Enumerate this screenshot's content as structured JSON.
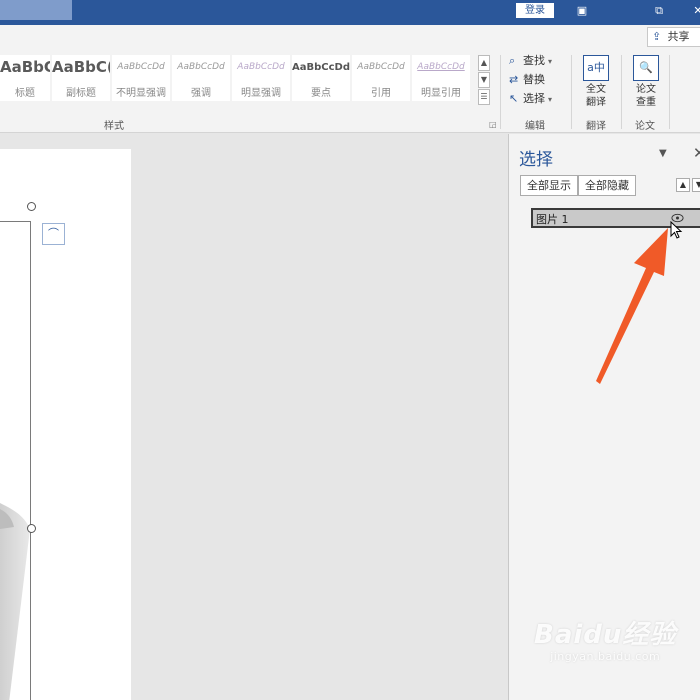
{
  "titlebar": {
    "login_label": "登录",
    "icons": [
      "ribbon-display-icon",
      "restore-icon",
      "close-icon"
    ],
    "close_glyph": "✕",
    "restore_glyph": "⧉",
    "ribbon_glyph": "▣"
  },
  "ribbon": {
    "share_label": "共享",
    "styles": [
      {
        "sample": "AaBbC(",
        "name": "标题"
      },
      {
        "sample": "AaBbC(",
        "name": "副标题"
      },
      {
        "sample": "AaBbCcDd",
        "name": "不明显强调"
      },
      {
        "sample": "AaBbCcDd",
        "name": "强调"
      },
      {
        "sample": "AaBbCcDd",
        "name": "明显强调"
      },
      {
        "sample": "AaBbCcDd",
        "name": "要点"
      },
      {
        "sample": "AaBbCcDd",
        "name": "引用"
      },
      {
        "sample": "AaBbCcDd",
        "name": "明显引用"
      }
    ],
    "styles_group_label": "样式",
    "editing": {
      "find_label": "查找",
      "replace_label": "替换",
      "select_label": "选择",
      "group_label": "编辑"
    },
    "translate": {
      "button_label_1": "全文",
      "button_label_2": "翻译",
      "group_label": "翻译"
    },
    "paper": {
      "button_label_1": "论文",
      "button_label_2": "查重",
      "group_label": "论文"
    }
  },
  "selection_pane": {
    "title": "选择",
    "show_all_label": "全部显示",
    "hide_all_label": "全部隐藏",
    "items": [
      {
        "name": "图片 1",
        "visible": true
      }
    ]
  },
  "watermark": {
    "brand": "Baidu经验",
    "url": "jingyan.baidu.com"
  },
  "colors": {
    "accent": "#2b579a",
    "arrow": "#f05a28"
  }
}
